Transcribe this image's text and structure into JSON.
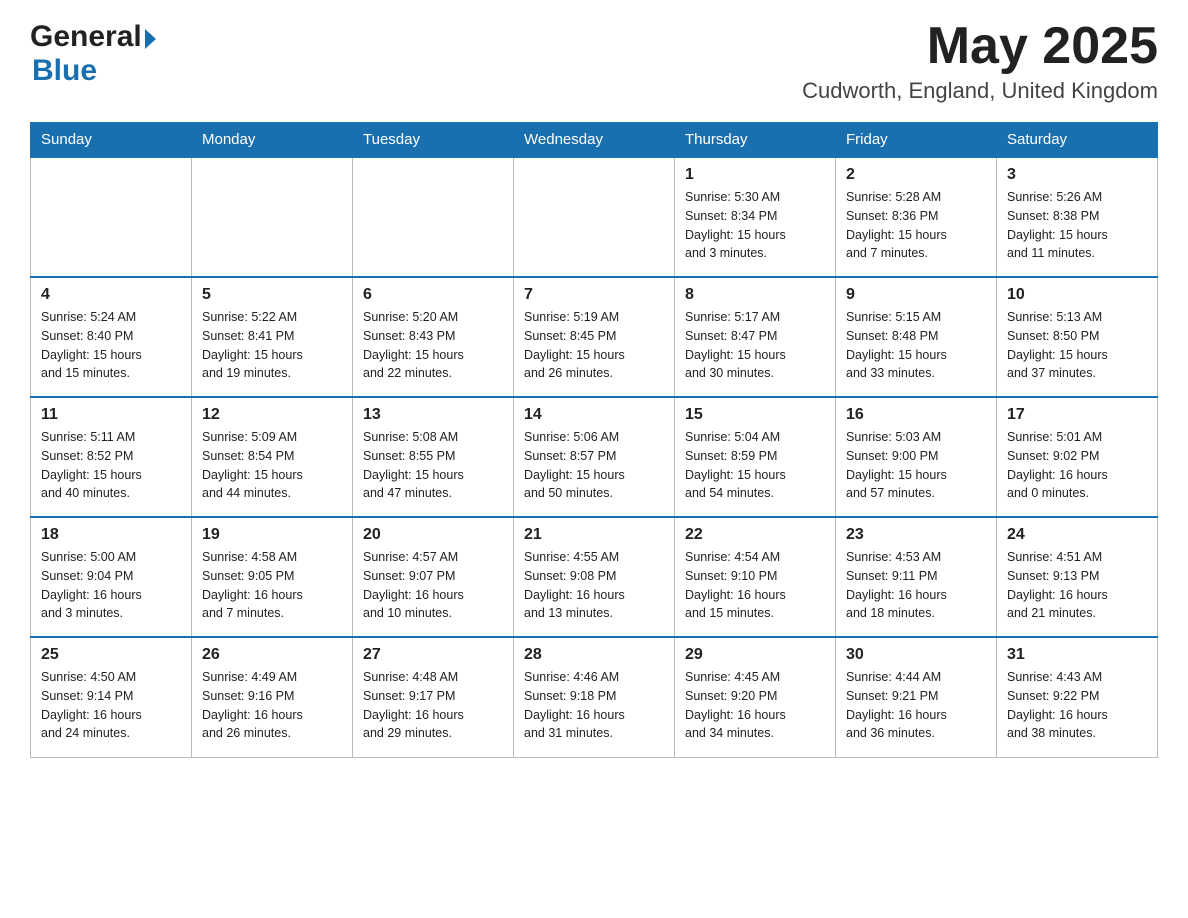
{
  "header": {
    "logo_general": "General",
    "logo_blue": "Blue",
    "month_title": "May 2025",
    "location": "Cudworth, England, United Kingdom"
  },
  "weekdays": [
    "Sunday",
    "Monday",
    "Tuesday",
    "Wednesday",
    "Thursday",
    "Friday",
    "Saturday"
  ],
  "weeks": [
    [
      {
        "day": "",
        "info": ""
      },
      {
        "day": "",
        "info": ""
      },
      {
        "day": "",
        "info": ""
      },
      {
        "day": "",
        "info": ""
      },
      {
        "day": "1",
        "info": "Sunrise: 5:30 AM\nSunset: 8:34 PM\nDaylight: 15 hours\nand 3 minutes."
      },
      {
        "day": "2",
        "info": "Sunrise: 5:28 AM\nSunset: 8:36 PM\nDaylight: 15 hours\nand 7 minutes."
      },
      {
        "day": "3",
        "info": "Sunrise: 5:26 AM\nSunset: 8:38 PM\nDaylight: 15 hours\nand 11 minutes."
      }
    ],
    [
      {
        "day": "4",
        "info": "Sunrise: 5:24 AM\nSunset: 8:40 PM\nDaylight: 15 hours\nand 15 minutes."
      },
      {
        "day": "5",
        "info": "Sunrise: 5:22 AM\nSunset: 8:41 PM\nDaylight: 15 hours\nand 19 minutes."
      },
      {
        "day": "6",
        "info": "Sunrise: 5:20 AM\nSunset: 8:43 PM\nDaylight: 15 hours\nand 22 minutes."
      },
      {
        "day": "7",
        "info": "Sunrise: 5:19 AM\nSunset: 8:45 PM\nDaylight: 15 hours\nand 26 minutes."
      },
      {
        "day": "8",
        "info": "Sunrise: 5:17 AM\nSunset: 8:47 PM\nDaylight: 15 hours\nand 30 minutes."
      },
      {
        "day": "9",
        "info": "Sunrise: 5:15 AM\nSunset: 8:48 PM\nDaylight: 15 hours\nand 33 minutes."
      },
      {
        "day": "10",
        "info": "Sunrise: 5:13 AM\nSunset: 8:50 PM\nDaylight: 15 hours\nand 37 minutes."
      }
    ],
    [
      {
        "day": "11",
        "info": "Sunrise: 5:11 AM\nSunset: 8:52 PM\nDaylight: 15 hours\nand 40 minutes."
      },
      {
        "day": "12",
        "info": "Sunrise: 5:09 AM\nSunset: 8:54 PM\nDaylight: 15 hours\nand 44 minutes."
      },
      {
        "day": "13",
        "info": "Sunrise: 5:08 AM\nSunset: 8:55 PM\nDaylight: 15 hours\nand 47 minutes."
      },
      {
        "day": "14",
        "info": "Sunrise: 5:06 AM\nSunset: 8:57 PM\nDaylight: 15 hours\nand 50 minutes."
      },
      {
        "day": "15",
        "info": "Sunrise: 5:04 AM\nSunset: 8:59 PM\nDaylight: 15 hours\nand 54 minutes."
      },
      {
        "day": "16",
        "info": "Sunrise: 5:03 AM\nSunset: 9:00 PM\nDaylight: 15 hours\nand 57 minutes."
      },
      {
        "day": "17",
        "info": "Sunrise: 5:01 AM\nSunset: 9:02 PM\nDaylight: 16 hours\nand 0 minutes."
      }
    ],
    [
      {
        "day": "18",
        "info": "Sunrise: 5:00 AM\nSunset: 9:04 PM\nDaylight: 16 hours\nand 3 minutes."
      },
      {
        "day": "19",
        "info": "Sunrise: 4:58 AM\nSunset: 9:05 PM\nDaylight: 16 hours\nand 7 minutes."
      },
      {
        "day": "20",
        "info": "Sunrise: 4:57 AM\nSunset: 9:07 PM\nDaylight: 16 hours\nand 10 minutes."
      },
      {
        "day": "21",
        "info": "Sunrise: 4:55 AM\nSunset: 9:08 PM\nDaylight: 16 hours\nand 13 minutes."
      },
      {
        "day": "22",
        "info": "Sunrise: 4:54 AM\nSunset: 9:10 PM\nDaylight: 16 hours\nand 15 minutes."
      },
      {
        "day": "23",
        "info": "Sunrise: 4:53 AM\nSunset: 9:11 PM\nDaylight: 16 hours\nand 18 minutes."
      },
      {
        "day": "24",
        "info": "Sunrise: 4:51 AM\nSunset: 9:13 PM\nDaylight: 16 hours\nand 21 minutes."
      }
    ],
    [
      {
        "day": "25",
        "info": "Sunrise: 4:50 AM\nSunset: 9:14 PM\nDaylight: 16 hours\nand 24 minutes."
      },
      {
        "day": "26",
        "info": "Sunrise: 4:49 AM\nSunset: 9:16 PM\nDaylight: 16 hours\nand 26 minutes."
      },
      {
        "day": "27",
        "info": "Sunrise: 4:48 AM\nSunset: 9:17 PM\nDaylight: 16 hours\nand 29 minutes."
      },
      {
        "day": "28",
        "info": "Sunrise: 4:46 AM\nSunset: 9:18 PM\nDaylight: 16 hours\nand 31 minutes."
      },
      {
        "day": "29",
        "info": "Sunrise: 4:45 AM\nSunset: 9:20 PM\nDaylight: 16 hours\nand 34 minutes."
      },
      {
        "day": "30",
        "info": "Sunrise: 4:44 AM\nSunset: 9:21 PM\nDaylight: 16 hours\nand 36 minutes."
      },
      {
        "day": "31",
        "info": "Sunrise: 4:43 AM\nSunset: 9:22 PM\nDaylight: 16 hours\nand 38 minutes."
      }
    ]
  ]
}
